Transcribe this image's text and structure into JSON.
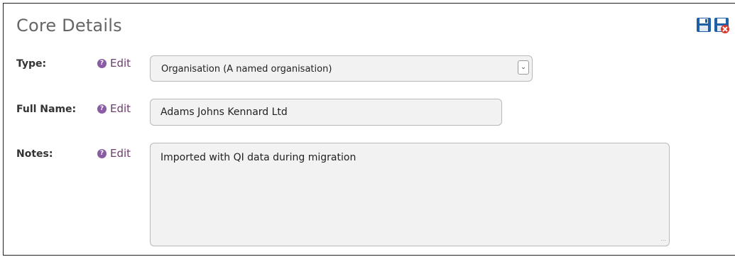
{
  "panel": {
    "title": "Core Details"
  },
  "toolbar": {
    "save_icon": "save-icon",
    "cancel_icon": "cancel-save-icon"
  },
  "fields": {
    "type": {
      "label": "Type:",
      "help_glyph": "?",
      "edit_label": "Edit",
      "value": "Organisation (A named organisation)"
    },
    "full_name": {
      "label": "Full Name:",
      "help_glyph": "?",
      "edit_label": "Edit",
      "value": "Adams Johns Kennard Ltd"
    },
    "notes": {
      "label": "Notes:",
      "help_glyph": "?",
      "edit_label": "Edit",
      "value": "Imported with QI data during migration"
    }
  },
  "colors": {
    "accent": "#6d3c6d",
    "help_badge": "#8a5ca3",
    "field_bg": "#f2f2f2",
    "save_blue": "#1f5fa8",
    "cancel_red": "#d9382c"
  }
}
